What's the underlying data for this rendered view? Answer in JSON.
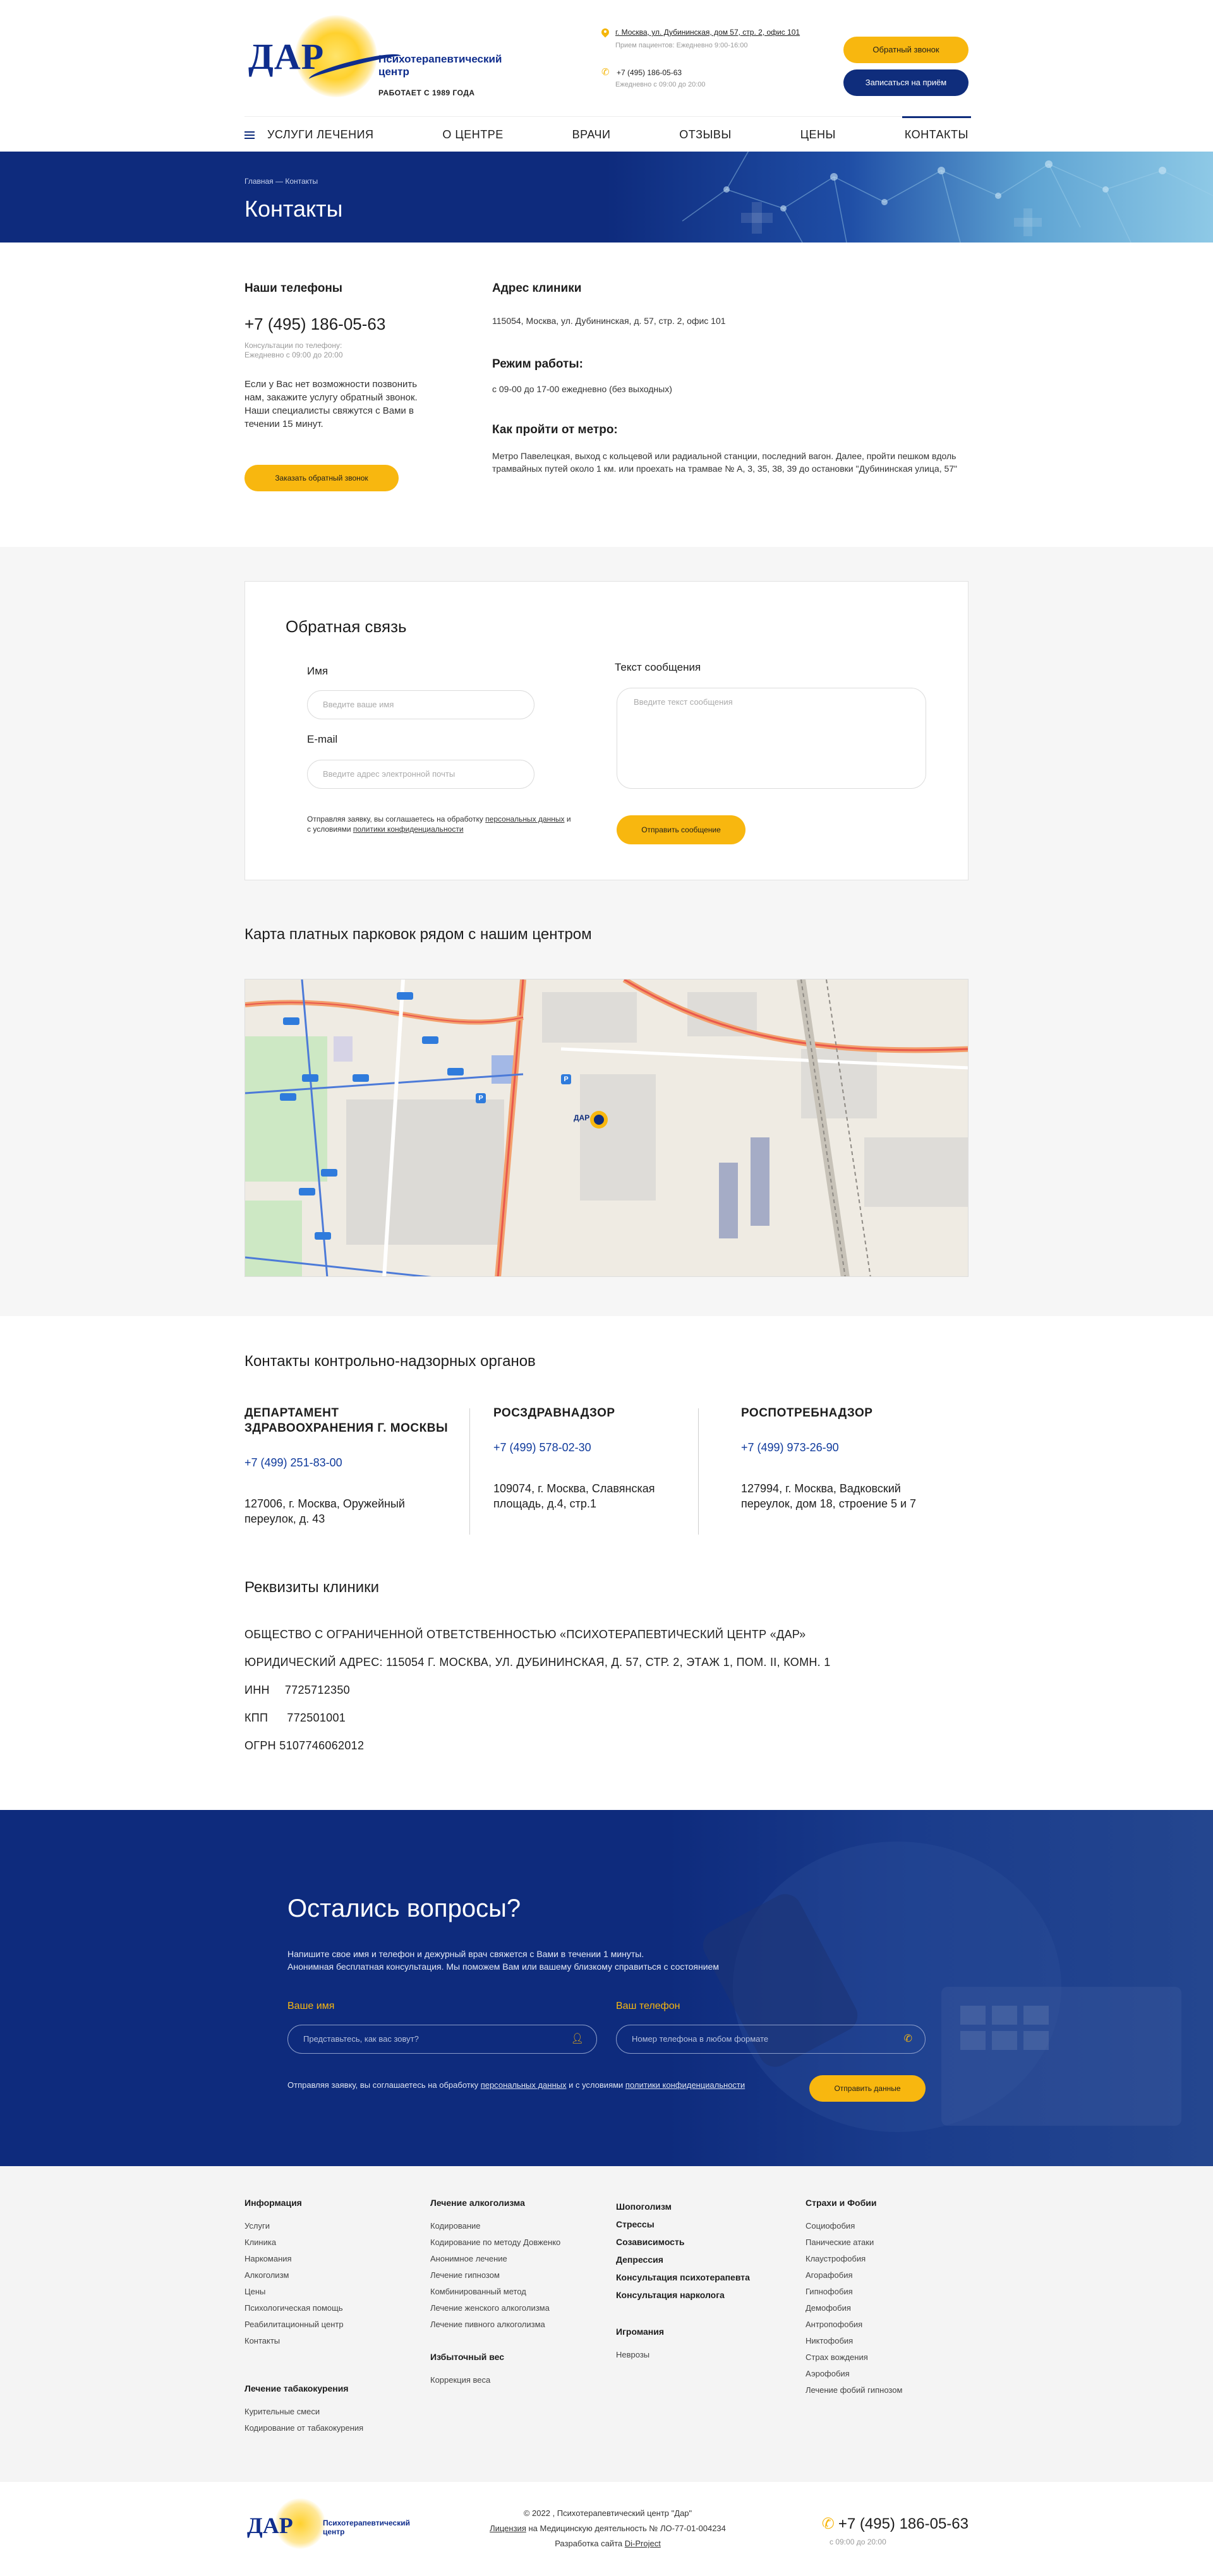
{
  "header": {
    "logo_text": "ДАР",
    "logo_name": "Психотерапевтический центр",
    "since": "РАБОТАЕТ С 1989 ГОДА",
    "address": "г. Москва, ул. Дубининская, дом 57, стр. 2, офис 101",
    "address_hours": "Прием пациентов: Ежедневно 9:00-16:00",
    "phone": "+7 (495) 186-05-63",
    "phone_hours": "Ежедневно с 09:00 до 20:00",
    "callback_btn": "Обратный звонок",
    "appointment_btn": "Записаться на приём"
  },
  "nav": {
    "items": [
      "УСЛУГИ ЛЕЧЕНИЯ",
      "О ЦЕНТРЕ",
      "ВРАЧИ",
      "ОТЗЫВЫ",
      "ЦЕНЫ",
      "КОНТАКТЫ"
    ]
  },
  "banner": {
    "breadcrumb": "Главная — Контакты",
    "title": "Контакты"
  },
  "contacts": {
    "phones_label": "Наши телефоны",
    "phone": "+7 (495) 186-05-63",
    "phone_note_1": "Консультации по телефону:",
    "phone_note_2": "Ежедневно с 09:00 до 20:00",
    "callback_text": "Если у Вас нет возможности позвонить нам, закажите услугу обратный звонок. Наши специалисты свяжутся с Вами в течении 15 минут.",
    "callback_btn": "Заказать обратный звонок",
    "address_label": "Адрес клиники",
    "address": "115054, Москва, ул. Дубининская, д. 57, стр. 2, офис 101",
    "hours_label": "Режим работы:",
    "hours": "с 09-00 до 17-00 ежедневно (без выходных)",
    "metro_label": "Как пройти от метро:",
    "metro": "Метро Павелецкая, выход с кольцевой или радиальной станции, последний вагон. Далее, пройти пешком вдоль трамвайных путей около 1 км. или проехать на трамвае № А, 3, 35, 38, 39 до остановки \"Дубининская улица, 57\""
  },
  "feedback": {
    "title": "Обратная связь",
    "name_label": "Имя",
    "name_placeholder": "Введите ваше имя",
    "email_label": "E-mail",
    "email_placeholder": "Введите адрес электронной почты",
    "message_label": "Текст сообщения",
    "message_placeholder": "Введите текст сообщения",
    "agree_1": "Отправляя заявку, вы соглашаетесь на обработку ",
    "agree_link_1": "персональных данных",
    "agree_2": " и с условиями ",
    "agree_link_2": "политики конфиденциальности",
    "submit": "Отправить сообщение"
  },
  "map": {
    "title": "Карта платных парковок рядом с нашим центром",
    "marker_label": "ДАР",
    "parking_sign": "P"
  },
  "supervisory": {
    "title": "Контакты контрольно-надзорных органов",
    "orgs": [
      {
        "name_1": "ДЕПАРТАМЕНТ",
        "name_2": "ЗДРАВООХРАНЕНИЯ Г. МОСКВЫ",
        "phone": "+7 (499) 251-83-00",
        "addr_1": "127006, г. Москва, Оружейный",
        "addr_2": "переулок, д. 43"
      },
      {
        "name_1": "РОСЗДРАВНАДЗОР",
        "name_2": "",
        "phone": "+7 (499) 578-02-30",
        "addr_1": "109074, г. Москва, Славянская",
        "addr_2": "площадь, д.4, стр.1"
      },
      {
        "name_1": "РОСПОТРЕБНАДЗОР",
        "name_2": "",
        "phone": "+7 (499) 973-26-90",
        "addr_1": "127994, г. Москва, Вадковский",
        "addr_2": "переулок, дом 18, строение 5 и 7"
      }
    ]
  },
  "requisites": {
    "title": "Реквизиты клиники",
    "org": "ОБЩЕСТВО С ОГРАНИЧЕННОЙ ОТВЕТСТВЕННОСТЬЮ «ПСИХОТЕРАПЕВТИЧЕСКИЙ ЦЕНТР «ДАР»",
    "legal_address": "ЮРИДИЧЕСКИЙ АДРЕС: 115054 Г. МОСКВА, УЛ. ДУБИНИНСКАЯ, Д. 57, СТР. 2, ЭТАЖ 1, ПОМ. II, КОМН. 1",
    "inn_label": "ИНН",
    "inn": "7725712350",
    "kpp_label": "КПП",
    "kpp": "772501001",
    "ogrn": "ОГРН 5107746062012"
  },
  "questions": {
    "title": "Остались вопросы?",
    "sub_1": "Напишите свое имя и телефон и дежурный врач свяжется с Вами в течении 1 минуты.",
    "sub_2": "Анонимная бесплатная консультация.  Мы поможем Вам или вашему близкому справиться с состоянием",
    "name_label": "Ваше имя",
    "name_placeholder": "Представьтесь, как вас зовут?",
    "phone_label": "Ваш телефон",
    "phone_placeholder": "Номер телефона в любом формате",
    "agree_1": "Отправляя заявку, вы соглашаетесь на обработку ",
    "agree_link_1": "персональных данных",
    "agree_2": " и с условиями ",
    "agree_link_2": "политики конфиденциальности",
    "submit": "Отправить данные"
  },
  "footer": {
    "col1_head": "Информация",
    "col1": [
      "Услуги",
      "Клиника",
      "Наркомания",
      "Алкоголизм",
      "Цены",
      "Психологическая помощь",
      "Реабилитационный центр",
      "Контакты"
    ],
    "col1b_head": "Лечение табакокурения",
    "col1b": [
      "Курительные смеси",
      "Кодирование от табакокурения"
    ],
    "col2_head": "Лечение алкоголизма",
    "col2": [
      "Кодирование",
      "Кодирование по методу Довженко",
      "Анонимное лечение",
      "Лечение гипнозом",
      "Комбинированный метод",
      "Лечение женского алкоголизма",
      "Лечение пивного алкоголизма"
    ],
    "col2b_head": "Избыточный вес",
    "col2b": [
      "Коррекция веса"
    ],
    "col3": [
      "Шопоголизм",
      "Стрессы",
      "Созависимость",
      "Депрессия",
      "Консультация психотерапевта",
      "Консультация нарколога"
    ],
    "col3b_head": "Игромания",
    "col3b": [
      "Неврозы"
    ],
    "col4_head": "Страхи и Фобии",
    "col4": [
      "Социофобия",
      "Панические атаки",
      "Клаустрофобия",
      "Агорафобия",
      "Гипнофобия",
      "Демофобия",
      "Антропофобия",
      "Никтофобия",
      "Страх вождения",
      "Аэрофобия",
      "Лечение фобий гипнозом"
    ]
  },
  "bottom": {
    "copyright": "© 2022 , Психотерапевтический центр \"Дар\"",
    "license_link": "Лицензия",
    "license_text": " на Медицинскую деятельность № ЛО-77-01-004234",
    "dev_text": "Разработка сайта ",
    "dev_link": "Di-Project",
    "phone": "+7 (495) 186-05-63",
    "phone_hours": "с 09:00 до 20:00"
  }
}
